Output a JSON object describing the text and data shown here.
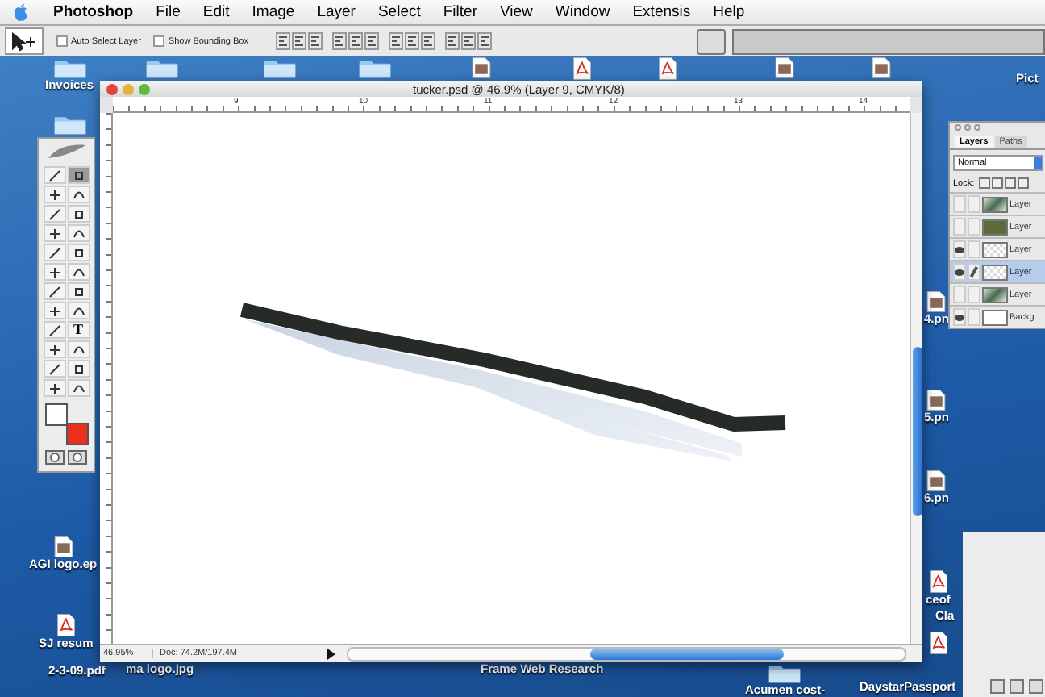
{
  "menu_bar": {
    "app_name": "Photoshop",
    "items": [
      "File",
      "Edit",
      "Image",
      "Layer",
      "Select",
      "Filter",
      "View",
      "Window",
      "Extensis",
      "Help"
    ]
  },
  "options_bar": {
    "checkboxes": [
      {
        "label": "Auto Select Layer",
        "checked": false
      },
      {
        "label": "Show Bounding Box",
        "checked": false
      }
    ]
  },
  "desktop_icons": [
    {
      "kind": "folder",
      "label": "Invoices"
    },
    {
      "kind": "folder"
    },
    {
      "kind": "folder"
    },
    {
      "kind": "folder"
    },
    {
      "kind": "image"
    },
    {
      "kind": "pdf"
    },
    {
      "kind": "pdf"
    },
    {
      "kind": "image"
    },
    {
      "kind": "image"
    },
    {
      "kind": "label",
      "label": "Pict"
    },
    {
      "kind": "folder"
    },
    {
      "kind": "image",
      "label": "AGI logo.ep"
    },
    {
      "kind": "pdf",
      "label": "SJ resum"
    },
    {
      "kind": "label",
      "label": "2-3-09.pdf"
    },
    {
      "kind": "label",
      "label": "ma logo.jpg"
    },
    {
      "kind": "label",
      "label": "Frame Web Research"
    },
    {
      "kind": "image",
      "label": "4.pn"
    },
    {
      "kind": "image",
      "label": "5.pn"
    },
    {
      "kind": "image",
      "label": "6.pn"
    },
    {
      "kind": "pdf",
      "label": "ceof"
    },
    {
      "kind": "label",
      "label": "Cla"
    },
    {
      "kind": "pdf"
    },
    {
      "kind": "folder",
      "label": "Acumen cost-"
    },
    {
      "kind": "label",
      "label": "DaystarPassport"
    }
  ],
  "document_window": {
    "title": "tucker.psd @ 46.9% (Layer 9, CMYK/8)",
    "ruler_labels": [
      "9",
      "10",
      "11",
      "12",
      "13",
      "14"
    ],
    "zoom": "46.95%",
    "doc_size": "Doc: 74.2M/197.4M"
  },
  "toolbox": {
    "tools": [
      {
        "selected": false
      },
      {
        "selected": true
      },
      {
        "selected": false
      },
      {
        "selected": false
      },
      {
        "selected": false
      },
      {
        "selected": false
      },
      {
        "selected": false
      },
      {
        "selected": false
      },
      {
        "selected": false
      },
      {
        "selected": false
      },
      {
        "selected": false
      },
      {
        "selected": false
      },
      {
        "selected": false
      },
      {
        "selected": false
      },
      {
        "selected": false
      },
      {
        "selected": false
      },
      {
        "selected": false
      },
      {
        "selected": false,
        "label": "T"
      },
      {
        "selected": false
      },
      {
        "selected": false
      },
      {
        "selected": false
      },
      {
        "selected": false
      },
      {
        "selected": false
      },
      {
        "selected": false
      }
    ],
    "swatches": [
      {
        "color": "#ffffff"
      },
      {
        "color": "#e8301c"
      }
    ]
  },
  "layers_panel": {
    "tabs": [
      {
        "label": "Layers",
        "selected": true
      },
      {
        "label": "Paths",
        "selected": false
      }
    ],
    "blend_mode": "Normal",
    "lock_label": "Lock:",
    "layers": [
      {
        "name": "Layer",
        "visible": false,
        "selected": false,
        "kind": "photo"
      },
      {
        "name": "Layer",
        "visible": false,
        "selected": false,
        "kind": "green"
      },
      {
        "name": "Layer",
        "visible": true,
        "selected": false,
        "kind": "transparent"
      },
      {
        "name": "Layer",
        "visible": true,
        "selected": true,
        "kind": "transparent"
      },
      {
        "name": "Layer",
        "visible": false,
        "selected": false,
        "kind": "photo"
      },
      {
        "name": "Backg",
        "visible": true,
        "selected": false,
        "kind": "white"
      }
    ]
  }
}
